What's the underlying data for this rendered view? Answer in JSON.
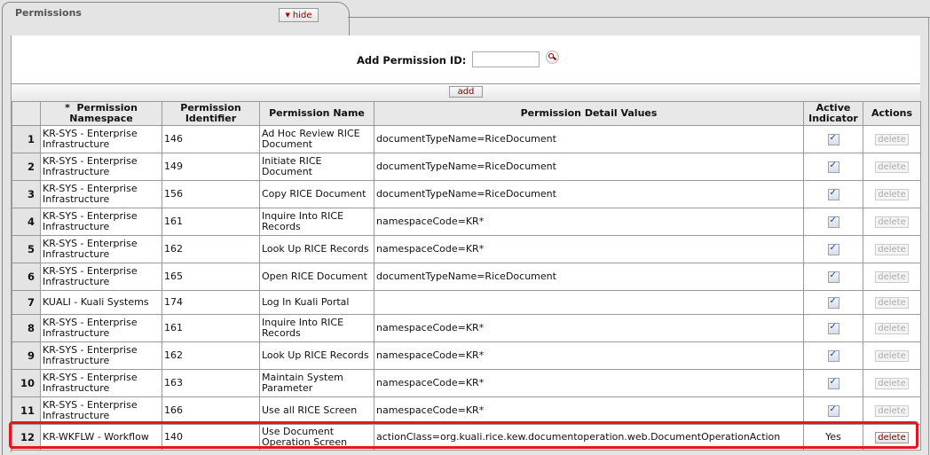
{
  "section": {
    "title": "Permissions",
    "hide_label": "hide"
  },
  "add_permission": {
    "label": "Add Permission ID:",
    "input_value": "",
    "lookup_icon": "magnifier-lookup-icon",
    "add_label": "add"
  },
  "table": {
    "headers": {
      "namespace_required_marker": "*",
      "namespace": "Permission Namespace",
      "identifier": "Permission Identifier",
      "name": "Permission Name",
      "detail_values": "Permission Detail Values",
      "active": "Active Indicator",
      "actions": "Actions"
    },
    "delete_label": "delete",
    "rows": [
      {
        "num": "1",
        "namespace": "KR-SYS - Enterprise Infrastructure",
        "identifier": "146",
        "name": "Ad Hoc Review RICE Document",
        "details": "documentTypeName=RiceDocument",
        "active": true,
        "active_text": "",
        "delete_enabled": false
      },
      {
        "num": "2",
        "namespace": "KR-SYS - Enterprise Infrastructure",
        "identifier": "149",
        "name": "Initiate RICE Document",
        "details": "documentTypeName=RiceDocument",
        "active": true,
        "active_text": "",
        "delete_enabled": false
      },
      {
        "num": "3",
        "namespace": "KR-SYS - Enterprise Infrastructure",
        "identifier": "156",
        "name": "Copy RICE Document",
        "details": "documentTypeName=RiceDocument",
        "active": true,
        "active_text": "",
        "delete_enabled": false
      },
      {
        "num": "4",
        "namespace": "KR-SYS - Enterprise Infrastructure",
        "identifier": "161",
        "name": "Inquire Into RICE Records",
        "details": "namespaceCode=KR*",
        "active": true,
        "active_text": "",
        "delete_enabled": false
      },
      {
        "num": "5",
        "namespace": "KR-SYS - Enterprise Infrastructure",
        "identifier": "162",
        "name": "Look Up RICE Records",
        "details": "namespaceCode=KR*",
        "active": true,
        "active_text": "",
        "delete_enabled": false
      },
      {
        "num": "6",
        "namespace": "KR-SYS - Enterprise Infrastructure",
        "identifier": "165",
        "name": "Open RICE Document",
        "details": "documentTypeName=RiceDocument",
        "active": true,
        "active_text": "",
        "delete_enabled": false
      },
      {
        "num": "7",
        "namespace": "KUALI - Kuali Systems",
        "identifier": "174",
        "name": "Log In Kuali Portal",
        "details": "",
        "active": true,
        "active_text": "",
        "delete_enabled": false
      },
      {
        "num": "8",
        "namespace": "KR-SYS - Enterprise Infrastructure",
        "identifier": "161",
        "name": "Inquire Into RICE Records",
        "details": "namespaceCode=KR*",
        "active": true,
        "active_text": "",
        "delete_enabled": false
      },
      {
        "num": "9",
        "namespace": "KR-SYS - Enterprise Infrastructure",
        "identifier": "162",
        "name": "Look Up RICE Records",
        "details": "namespaceCode=KR*",
        "active": true,
        "active_text": "",
        "delete_enabled": false
      },
      {
        "num": "10",
        "namespace": "KR-SYS - Enterprise Infrastructure",
        "identifier": "163",
        "name": "Maintain System Parameter",
        "details": "namespaceCode=KR*",
        "active": true,
        "active_text": "",
        "delete_enabled": false
      },
      {
        "num": "11",
        "namespace": "KR-SYS - Enterprise Infrastructure",
        "identifier": "166",
        "name": "Use all RICE Screen",
        "details": "namespaceCode=KR*",
        "active": true,
        "active_text": "",
        "delete_enabled": false
      },
      {
        "num": "12",
        "namespace": "KR-WKFLW - Workflow",
        "identifier": "140",
        "name": "Use Document Operation Screen",
        "details": "actionClass=org.kuali.rice.kew.documentoperation.web.DocumentOperationAction",
        "active": false,
        "active_text": "Yes",
        "delete_enabled": true,
        "highlighted": true
      }
    ]
  },
  "colors": {
    "highlight": "#e8141f",
    "button_text": "#7a0000"
  }
}
